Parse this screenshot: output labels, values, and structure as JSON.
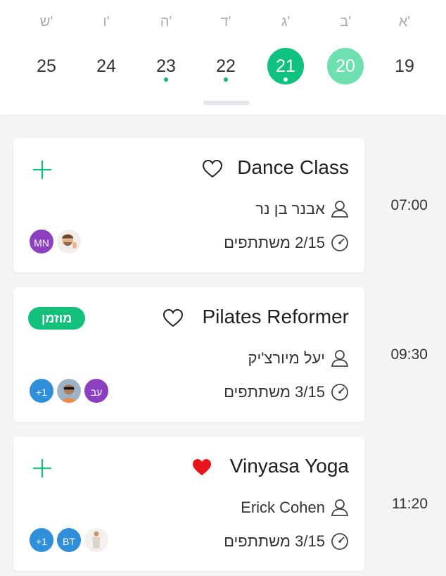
{
  "week": {
    "days": [
      {
        "letter": "ש'",
        "number": "25",
        "state": "normal",
        "has_event": false
      },
      {
        "letter": "ו'",
        "number": "24",
        "state": "normal",
        "has_event": false
      },
      {
        "letter": "ה'",
        "number": "23",
        "state": "normal",
        "has_event": true
      },
      {
        "letter": "ד'",
        "number": "22",
        "state": "normal",
        "has_event": true
      },
      {
        "letter": "ג'",
        "number": "21",
        "state": "today",
        "has_event": true
      },
      {
        "letter": "ב'",
        "number": "20",
        "state": "selected",
        "has_event": false
      },
      {
        "letter": "א'",
        "number": "19",
        "state": "normal",
        "has_event": false
      }
    ]
  },
  "classes": [
    {
      "time": "07:00",
      "title": "Dance Class",
      "favorite": false,
      "instructor": "אבנר בן נר",
      "participants": "2/15 משתתפים",
      "action": "add",
      "attendees": [
        {
          "type": "initials",
          "text": "MN",
          "color": "#8c3fbf"
        },
        {
          "type": "photo",
          "icon": "memoji-avatar"
        }
      ]
    },
    {
      "time": "09:30",
      "title": "Pilates Reformer",
      "favorite": false,
      "instructor": "יעל מיורצ'יק",
      "participants": "3/15 משתתפים",
      "action": "booked",
      "badge": "מוזמן",
      "attendees": [
        {
          "type": "initials",
          "text": "+1",
          "color": "#2f8fd8"
        },
        {
          "type": "photo",
          "icon": "photo-avatar"
        },
        {
          "type": "initials",
          "text": "עב",
          "color": "#8c3fbf"
        }
      ]
    },
    {
      "time": "11:20",
      "title": "Vinyasa Yoga",
      "favorite": true,
      "instructor": "Erick Cohen",
      "participants": "3/15 משתתפים",
      "action": "add",
      "attendees": [
        {
          "type": "initials",
          "text": "+1",
          "color": "#2f8fd8"
        },
        {
          "type": "initials",
          "text": "BT",
          "color": "#2f8fd8"
        },
        {
          "type": "photo",
          "icon": "photo-avatar"
        }
      ]
    }
  ],
  "colors": {
    "accent": "#0fc27d",
    "accent_light": "#6ee0b0",
    "favorite": "#e8161b",
    "avatar_purple": "#8c3fbf",
    "avatar_blue": "#2f8fd8"
  }
}
